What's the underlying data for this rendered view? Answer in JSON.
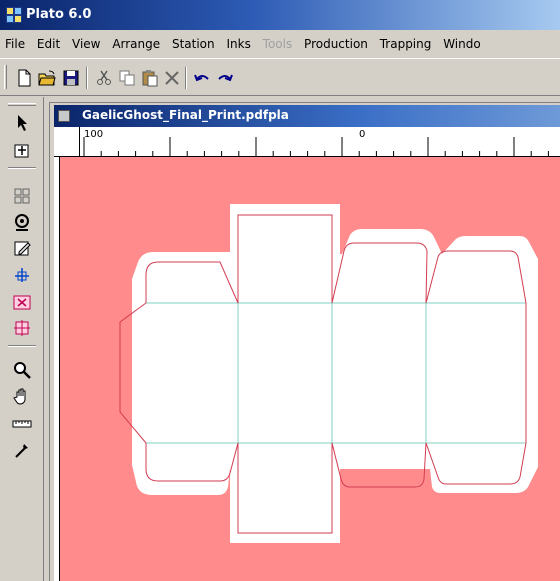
{
  "app": {
    "title": "Plato 6.0"
  },
  "menu": [
    {
      "label": "File",
      "enabled": true
    },
    {
      "label": "Edit",
      "enabled": true
    },
    {
      "label": "View",
      "enabled": true
    },
    {
      "label": "Arrange",
      "enabled": true
    },
    {
      "label": "Station",
      "enabled": true
    },
    {
      "label": "Inks",
      "enabled": true
    },
    {
      "label": "Tools",
      "enabled": false
    },
    {
      "label": "Production",
      "enabled": true
    },
    {
      "label": "Trapping",
      "enabled": true
    },
    {
      "label": "Windo",
      "enabled": true
    }
  ],
  "toolbar": {
    "buttons": [
      "new-document-icon",
      "open-folder-icon",
      "save-disk-icon",
      "cut-icon",
      "copy-icon",
      "paste-icon",
      "delete-icon",
      "undo-icon",
      "redo-icon"
    ]
  },
  "toolbox": {
    "tools": [
      "select-arrow-icon",
      "node-edit-icon",
      "transform-icon",
      "center-target-icon",
      "edit-pencil-icon",
      "grid-snap-icon",
      "cut-tool-icon",
      "step-repeat-icon",
      "zoom-icon",
      "hand-pan-icon",
      "measure-ruler-icon",
      "eyedropper-icon"
    ]
  },
  "document": {
    "title": "GaelicGhost_Final_Print.pdfpla",
    "ruler_labels": [
      "100",
      "0"
    ],
    "background_color": "#ff8b8c",
    "die_line_color": "#d23c50",
    "crease_line_color": "#7fd0c0"
  }
}
